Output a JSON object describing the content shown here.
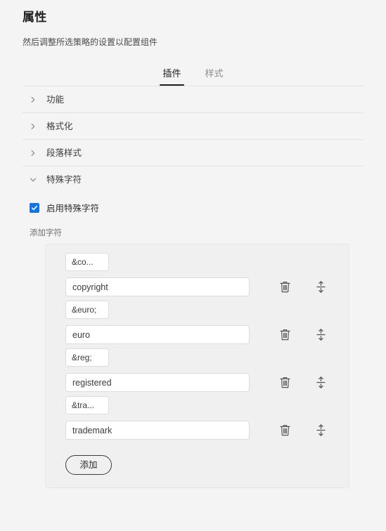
{
  "header": {
    "title": "属性",
    "subtitle": "然后调整所选策略的设置以配置组件"
  },
  "tabs": [
    {
      "label": "插件",
      "active": true
    },
    {
      "label": "样式",
      "active": false
    }
  ],
  "accordion": [
    {
      "label": "功能",
      "expanded": false,
      "icon": "chevron-right-icon"
    },
    {
      "label": "格式化",
      "expanded": false,
      "icon": "chevron-right-icon"
    },
    {
      "label": "段落样式",
      "expanded": false,
      "icon": "chevron-right-icon"
    },
    {
      "label": "特殊字符",
      "expanded": true,
      "icon": "chevron-down-icon"
    }
  ],
  "special_characters": {
    "enable_checkbox": {
      "label": "启用特殊字符",
      "checked": true,
      "accent_color": "#1473E6"
    },
    "add_characters_label": "添加字符",
    "rows": [
      {
        "entity_value": "&co...",
        "entity_placeholder": "实体",
        "name_value": "copyright",
        "name_placeholder": "名称",
        "delete_icon": "trash-icon",
        "drag_icon": "drag-vertical-icon"
      },
      {
        "entity_value": "&euro;",
        "entity_placeholder": "实体",
        "name_value": "euro",
        "name_placeholder": "名称",
        "delete_icon": "trash-icon",
        "drag_icon": "drag-vertical-icon"
      },
      {
        "entity_value": "&reg;",
        "entity_placeholder": "实体",
        "name_value": "registered",
        "name_placeholder": "名称",
        "delete_icon": "trash-icon",
        "drag_icon": "drag-vertical-icon"
      },
      {
        "entity_value": "&tra...",
        "entity_placeholder": "实体",
        "name_value": "trademark",
        "name_placeholder": "名称",
        "delete_icon": "trash-icon",
        "drag_icon": "drag-vertical-icon"
      }
    ],
    "add_button_label": "添加"
  },
  "theme": {
    "background": "#F4F4F4",
    "panel_background": "#F0F0F0",
    "divider": "#E1E1E1",
    "text_primary": "#2C2C2C",
    "text_secondary": "#6E6E6E",
    "accent": "#1473E6"
  }
}
